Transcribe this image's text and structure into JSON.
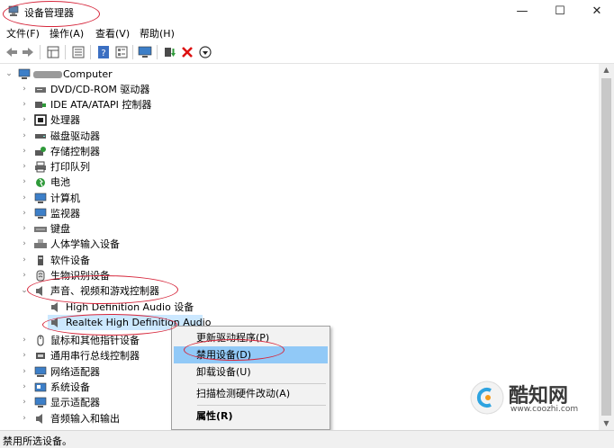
{
  "window": {
    "title": "设备管理器",
    "minimize": "—",
    "maximize": "☐",
    "close": "✕"
  },
  "menu": [
    {
      "label": "文件(F)"
    },
    {
      "label": "操作(A)"
    },
    {
      "label": "查看(V)"
    },
    {
      "label": "帮助(H)"
    }
  ],
  "toolbar_icons": [
    "back-icon",
    "forward-icon",
    "properties-grid-icon",
    "list-icon",
    "help-icon",
    "details-icon",
    "monitor-icon",
    "update-driver-icon",
    "uninstall-icon",
    "download-icon"
  ],
  "tree": {
    "root": "Computer",
    "categories": [
      {
        "label": "DVD/CD-ROM 驱动器"
      },
      {
        "label": "IDE ATA/ATAPI 控制器"
      },
      {
        "label": "处理器"
      },
      {
        "label": "磁盘驱动器"
      },
      {
        "label": "存储控制器"
      },
      {
        "label": "打印队列"
      },
      {
        "label": "电池"
      },
      {
        "label": "计算机"
      },
      {
        "label": "监视器"
      },
      {
        "label": "键盘"
      },
      {
        "label": "人体学输入设备"
      },
      {
        "label": "软件设备"
      },
      {
        "label": "生物识别设备"
      },
      {
        "label": "声音、视频和游戏控制器"
      },
      {
        "label": "High Definition Audio 设备"
      },
      {
        "label": "Realtek High Definition Audio"
      },
      {
        "label": "鼠标和其他指针设备"
      },
      {
        "label": "通用串行总线控制器"
      },
      {
        "label": "网络适配器"
      },
      {
        "label": "系统设备"
      },
      {
        "label": "显示适配器"
      },
      {
        "label": "音频输入和输出"
      }
    ]
  },
  "context_menu": {
    "items": [
      {
        "label": "更新驱动程序(P)"
      },
      {
        "label": "禁用设备(D)"
      },
      {
        "label": "卸载设备(U)"
      },
      {
        "label": "扫描检测硬件改动(A)"
      },
      {
        "label": "属性(R)"
      }
    ]
  },
  "status": {
    "text": "禁用所选设备。"
  },
  "watermark": {
    "brand": "酷知网",
    "url": "www.coozhi.com"
  },
  "colors": {
    "annotation": "#d6263b",
    "highlight": "#91c9f7",
    "selection": "#cce8ff"
  }
}
